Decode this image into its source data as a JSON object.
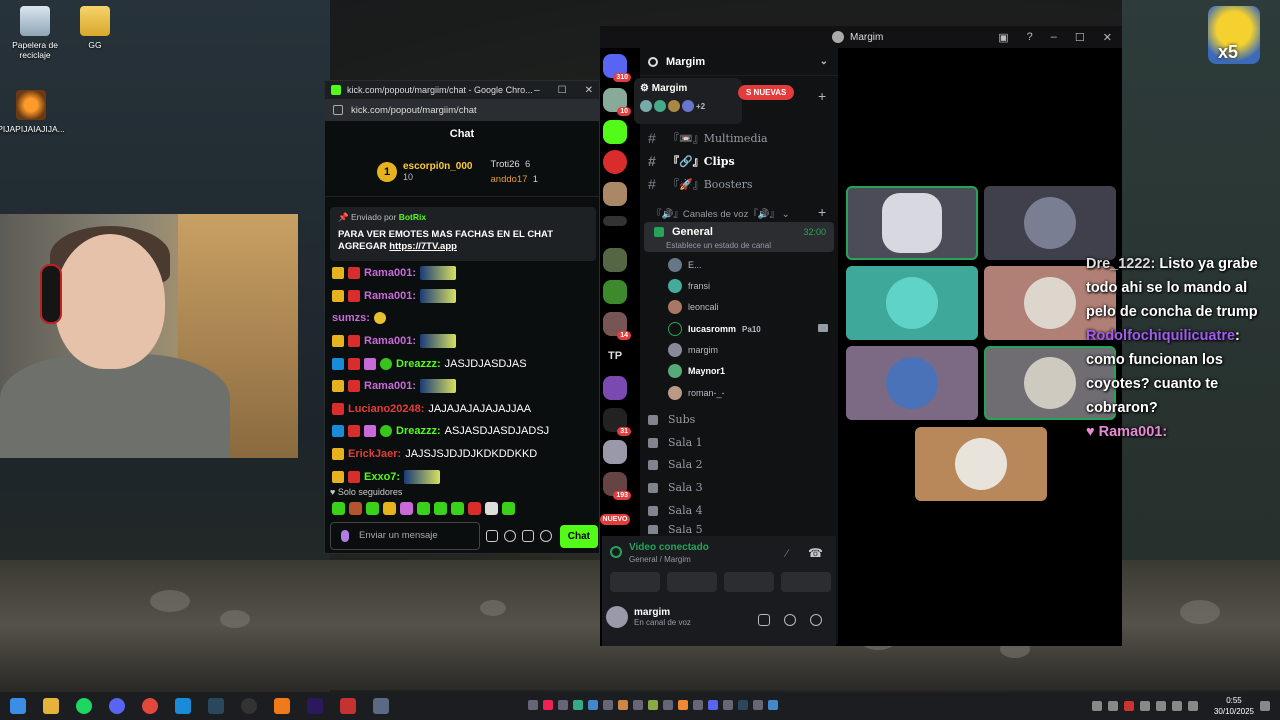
{
  "desktop": {
    "icons": [
      {
        "label": "Papelera de reciclaje"
      },
      {
        "label": "GG"
      },
      {
        "label": "PIJAPIJAIAJIJA..."
      }
    ]
  },
  "kick_window": {
    "title": "kick.com/popout/margiim/chat - Google Chro...",
    "url": "kick.com/popout/margiim/chat",
    "header": "Chat",
    "leaderboard": {
      "rank": "1",
      "first_name": "escorpi0n_000",
      "first_value": "10",
      "second_name": "Troti26",
      "second_value": "6",
      "third_name": "anddo17",
      "third_value": "1"
    },
    "pinned": {
      "sent_by_label": "Enviado por",
      "sender": "BotRix",
      "line1": "PARA VER EMOTES MAS FACHAS EN EL CHAT",
      "line2_prefix": "AGREGAR",
      "link": "https://7TV.app"
    },
    "messages": [
      {
        "user": "Rama001:",
        "text": "",
        "color": "#c86ad8"
      },
      {
        "user": "Rama001:",
        "text": "",
        "color": "#c86ad8"
      },
      {
        "user": "sumzs:",
        "text": "",
        "color": "#c86ad8"
      },
      {
        "user": "Rama001:",
        "text": "",
        "color": "#c86ad8"
      },
      {
        "user": "Dreazzz:",
        "text": "JASJDJASDJAS",
        "color": "#53fc18"
      },
      {
        "user": "Rama001:",
        "text": "",
        "color": "#c86ad8"
      },
      {
        "user": "Luciano20248:",
        "text": "JAJAJAJAJAJAJJAA",
        "color": "#e23c3c"
      },
      {
        "user": "Dreazzz:",
        "text": "ASJASDJASDJADSJ",
        "color": "#53fc18"
      },
      {
        "user": "ErickJaer:",
        "text": "JAJSJSJDJDJKDKDDKKD",
        "color": "#e23c3c"
      },
      {
        "user": "Exxo7:",
        "text": "",
        "color": "#53fc18"
      }
    ],
    "followers_only": "Solo seguidores",
    "input_placeholder": "Enviar un mensaje",
    "chat_button": "Chat",
    "accent": "#53fc18"
  },
  "discord": {
    "window_user": "Margim",
    "server_name": "Margim",
    "tooltip_server": "Margim",
    "tooltip_count": "+2",
    "new_badge": "S NUEVAS",
    "server_badges": [
      "310",
      "10",
      "14",
      "31",
      "193"
    ],
    "server_initials": "TP",
    "server_new": "NUEVO",
    "channels": [
      {
        "name": "『📼』Multimedia",
        "active": false
      },
      {
        "name": "『🔗』Clips",
        "active": true
      },
      {
        "name": "『🚀』Boosters",
        "active": false
      }
    ],
    "voice_category": "『🔊』Canales de voz『🔊』",
    "voice_channel": {
      "name": "General",
      "time": "32:00",
      "status": "Establece un estado de canal"
    },
    "voice_users": [
      "E...",
      "fransi",
      "leoncali",
      "lucasromm",
      "margim",
      "Maynor1",
      "roman-_-"
    ],
    "voice_user_tag": "Pa10",
    "other_voice": [
      "Subs",
      "Sala 1",
      "Sala 2",
      "Sala 3",
      "Sala 4",
      "Sala 5"
    ],
    "connection": {
      "status": "Video conectado",
      "location": "General / Margim"
    },
    "me": {
      "name": "margim",
      "status": "En canal de voz"
    }
  },
  "overlay_chat": {
    "line1_user": "Dre_1222:",
    "line1_text": "Listo ya grabe todo ahi se lo mando al pelo de concha de trump",
    "line2_user": "Rodolfochiquilicuatre",
    "line2_text": ": como funcionan los coyotes? cuanto te cobraron?",
    "line3_user": "Rama001:"
  },
  "sticker": {
    "label": "x5"
  },
  "taskbar": {
    "time": "0:55",
    "date": "30/10/2025"
  }
}
